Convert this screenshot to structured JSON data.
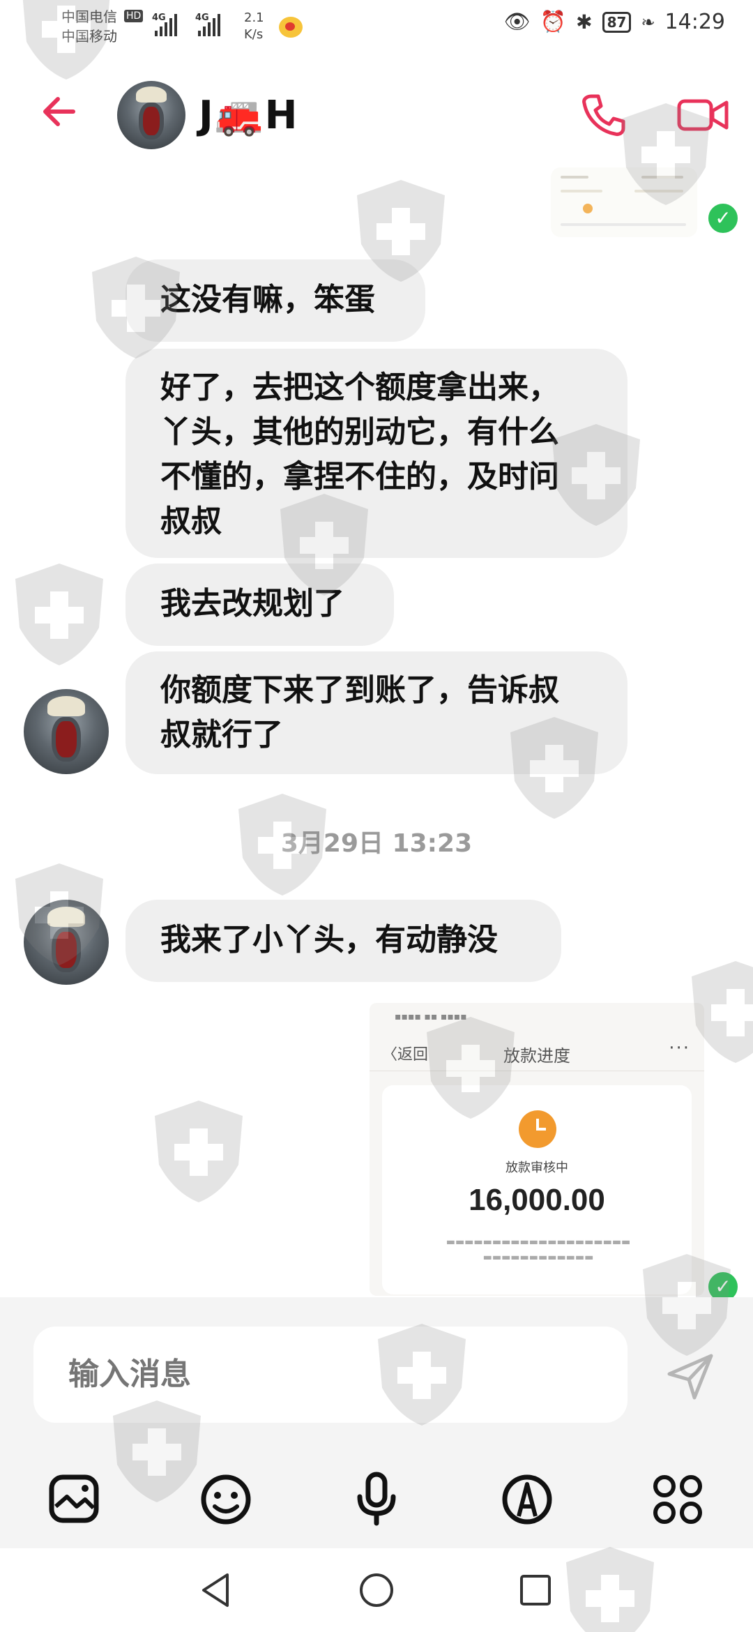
{
  "status_bar": {
    "carrier1": "中国电信",
    "carrier2": "中国移动",
    "hd": "HD",
    "network1": "4G",
    "network2": "4G",
    "speed_value": "2.1",
    "speed_unit": "K/s",
    "battery": "87",
    "time": "14:29"
  },
  "header": {
    "contact_name": "J🚒H"
  },
  "messages": {
    "m1": "这没有嘛，笨蛋",
    "m2_line1": "好了，去把这个额度拿出来，",
    "m2_line2": "丫头，其他的别动它，有什么",
    "m2_line3": "不懂的，拿捏不住的，及时问",
    "m2_line4": "叔叔",
    "m3": "我去改规划了",
    "m4_line1": "你额度下来了到账了，告诉叔",
    "m4_line2": "叔就行了",
    "timestamp": "3月29日 13:23",
    "m5": "我来了小丫头，有动静没"
  },
  "screenshot_image": {
    "back_label": "〈返回",
    "title": "放款进度",
    "more": "···",
    "status_label": "放款审核中",
    "amount": "16,000.00"
  },
  "input": {
    "placeholder": "输入消息"
  },
  "colors": {
    "accent": "#e8325a",
    "bubble": "#efefef",
    "check": "#2ec25a"
  },
  "icons": {
    "back": "arrow-left-icon",
    "call": "phone-icon",
    "video": "video-camera-icon",
    "send": "send-icon",
    "gallery": "image-icon",
    "emoji": "smiley-icon",
    "voice": "microphone-icon",
    "pen": "pen-icon",
    "more": "apps-grid-icon"
  }
}
